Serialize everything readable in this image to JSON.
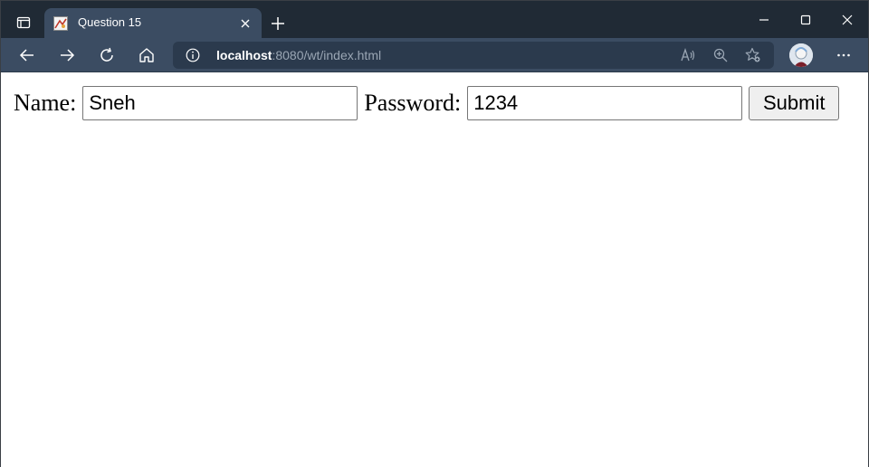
{
  "tab": {
    "title": "Question 15",
    "close_label": "×"
  },
  "address_bar": {
    "host": "localhost",
    "rest": ":8080/wt/index.html"
  },
  "form": {
    "name_label": "Name:",
    "name_value": "Sneh",
    "password_label": "Password:",
    "password_value": "1234",
    "submit_label": "Submit"
  },
  "colors": {
    "tabstrip": "#202a35",
    "toolbar": "#3b4c62",
    "address": "#2b3a4d"
  },
  "icons": [
    "tab-actions-icon",
    "favicon-icon",
    "close-icon",
    "plus-icon",
    "minimize-icon",
    "maximize-icon",
    "window-close-icon",
    "back-icon",
    "forward-icon",
    "refresh-icon",
    "home-icon",
    "info-icon",
    "read-aloud-icon",
    "zoom-icon",
    "favorites-icon",
    "more-icon"
  ]
}
